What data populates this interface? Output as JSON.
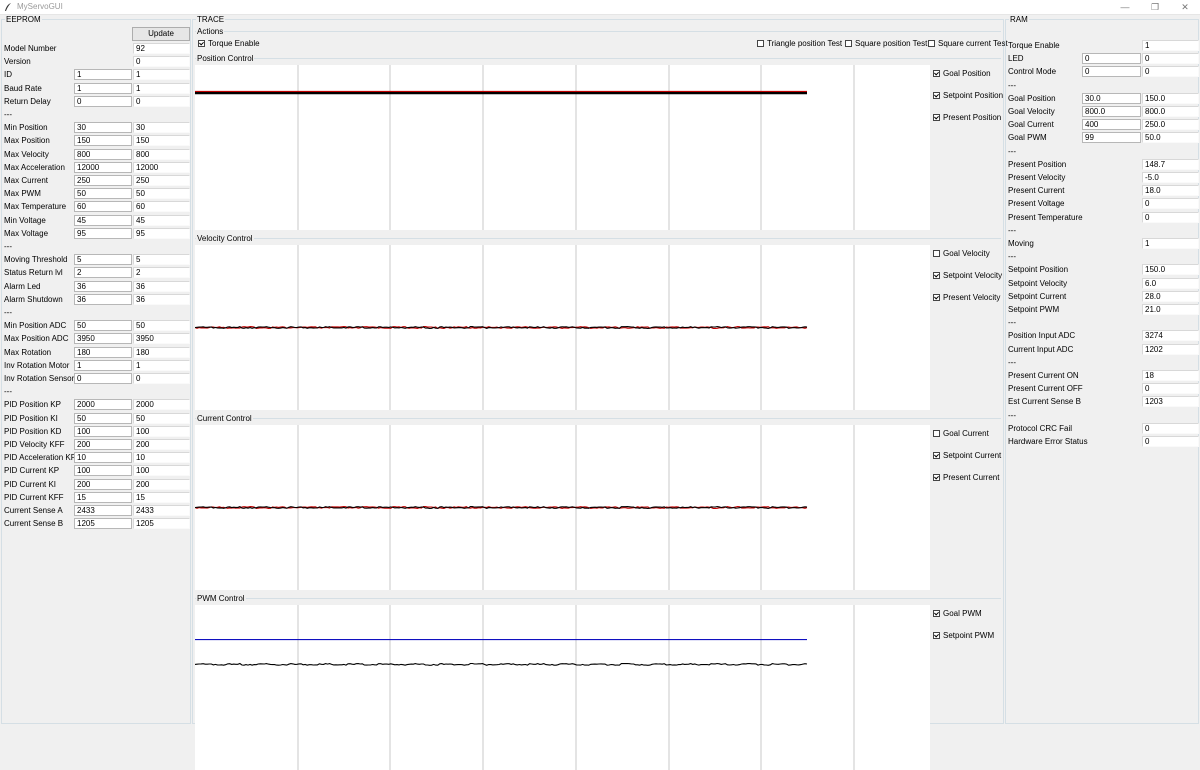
{
  "window": {
    "title": "MyServoGUI",
    "min_glyph": "—",
    "max_glyph": "❐",
    "close_glyph": "✕"
  },
  "eeprom": {
    "legend": "EEPROM",
    "update_label": "Update",
    "rows": [
      {
        "label": "Model Number",
        "value": null,
        "read": "92"
      },
      {
        "label": "Version",
        "value": null,
        "read": "0"
      },
      {
        "label": "ID",
        "value": "1",
        "read": "1"
      },
      {
        "label": "Baud Rate",
        "value": "1",
        "read": "1"
      },
      {
        "label": "Return Delay",
        "value": "0",
        "read": "0"
      },
      {
        "label": "---",
        "sep": true
      },
      {
        "label": "Min Position",
        "value": "30",
        "read": "30"
      },
      {
        "label": "Max Position",
        "value": "150",
        "read": "150"
      },
      {
        "label": "Max Velocity",
        "value": "800",
        "read": "800"
      },
      {
        "label": "Max Acceleration",
        "value": "12000",
        "read": "12000"
      },
      {
        "label": "Max Current",
        "value": "250",
        "read": "250"
      },
      {
        "label": "Max PWM",
        "value": "50",
        "read": "50"
      },
      {
        "label": "Max Temperature",
        "value": "60",
        "read": "60"
      },
      {
        "label": "Min Voltage",
        "value": "45",
        "read": "45"
      },
      {
        "label": "Max Voltage",
        "value": "95",
        "read": "95"
      },
      {
        "label": "---",
        "sep": true
      },
      {
        "label": "Moving Threshold",
        "value": "5",
        "read": "5"
      },
      {
        "label": "Status Return lvl",
        "value": "2",
        "read": "2"
      },
      {
        "label": "Alarm Led",
        "value": "36",
        "read": "36"
      },
      {
        "label": "Alarm Shutdown",
        "value": "36",
        "read": "36"
      },
      {
        "label": "---",
        "sep": true
      },
      {
        "label": "Min Position ADC",
        "value": "50",
        "read": "50"
      },
      {
        "label": "Max Position ADC",
        "value": "3950",
        "read": "3950"
      },
      {
        "label": "Max Rotation",
        "value": "180",
        "read": "180"
      },
      {
        "label": "Inv Rotation Motor",
        "value": "1",
        "read": "1"
      },
      {
        "label": "Inv Rotation Sensor",
        "value": "0",
        "read": "0"
      },
      {
        "label": "---",
        "sep": true
      },
      {
        "label": "PID Position KP",
        "value": "2000",
        "read": "2000"
      },
      {
        "label": "PID Position KI",
        "value": "50",
        "read": "50"
      },
      {
        "label": "PID Position KD",
        "value": "100",
        "read": "100"
      },
      {
        "label": "PID Velocity KFF",
        "value": "200",
        "read": "200"
      },
      {
        "label": "PID Acceleration KFF",
        "value": "10",
        "read": "10"
      },
      {
        "label": "PID Current KP",
        "value": "100",
        "read": "100"
      },
      {
        "label": "PID Current KI",
        "value": "200",
        "read": "200"
      },
      {
        "label": "PID Current KFF",
        "value": "15",
        "read": "15"
      },
      {
        "label": "Current Sense A",
        "value": "2433",
        "read": "2433"
      },
      {
        "label": "Current Sense B",
        "value": "1205",
        "read": "1205"
      }
    ]
  },
  "trace": {
    "legend": "TRACE",
    "actions": {
      "legend": "Actions",
      "torque_enable": {
        "label": "Torque Enable",
        "checked": true
      },
      "tests": [
        {
          "label": "Triangle position Test",
          "checked": false
        },
        {
          "label": "Square position Test",
          "checked": false
        },
        {
          "label": "Square current Test",
          "checked": false
        }
      ]
    },
    "panels": [
      {
        "legend": "Position Control",
        "checks": [
          {
            "label": "Goal Position",
            "checked": true
          },
          {
            "label": "Setpoint Position",
            "checked": true
          },
          {
            "label": "Present Position",
            "checked": true
          }
        ],
        "lines": [
          {
            "level": 0.84,
            "color": "#c00000"
          },
          {
            "level": 0.83,
            "color": "#000000",
            "thick": true
          }
        ]
      },
      {
        "legend": "Velocity Control",
        "checks": [
          {
            "label": "Goal Velocity",
            "checked": false
          },
          {
            "label": "Setpoint Velocity",
            "checked": true
          },
          {
            "label": "Present Velocity",
            "checked": true
          }
        ],
        "lines": [
          {
            "level": 0.5,
            "color": "#c00000",
            "noise": true
          },
          {
            "level": 0.5,
            "color": "#000000",
            "noise": true
          }
        ]
      },
      {
        "legend": "Current Control",
        "checks": [
          {
            "label": "Goal Current",
            "checked": false
          },
          {
            "label": "Setpoint Current",
            "checked": true
          },
          {
            "label": "Present Current",
            "checked": true
          }
        ],
        "lines": [
          {
            "level": 0.5,
            "color": "#c00000",
            "noise": true
          },
          {
            "level": 0.5,
            "color": "#000000",
            "noise": true
          }
        ]
      },
      {
        "legend": "PWM Control",
        "checks": [
          {
            "label": "Goal PWM",
            "checked": true
          },
          {
            "label": "Setpoint PWM",
            "checked": true
          }
        ],
        "lines": [
          {
            "level": 0.79,
            "color": "#1010c0"
          },
          {
            "level": 0.64,
            "color": "#000000",
            "noise": true
          }
        ]
      }
    ]
  },
  "ram": {
    "legend": "RAM",
    "rows": [
      {
        "label": "Torque Enable",
        "value": null,
        "read": "1"
      },
      {
        "label": "LED",
        "value": "0",
        "read": "0"
      },
      {
        "label": "Control Mode",
        "value": "0",
        "read": "0"
      },
      {
        "label": "---",
        "sep": true
      },
      {
        "label": "Goal Position",
        "value": "30.0",
        "read": "150.0"
      },
      {
        "label": "Goal Velocity",
        "value": "800.0",
        "read": "800.0"
      },
      {
        "label": "Goal Current",
        "value": "400",
        "read": "250.0"
      },
      {
        "label": "Goal PWM",
        "value": "99",
        "read": "50.0"
      },
      {
        "label": "---",
        "sep": true
      },
      {
        "label": "Present Position",
        "value": null,
        "read": "148.7"
      },
      {
        "label": "Present Velocity",
        "value": null,
        "read": "-5.0"
      },
      {
        "label": "Present Current",
        "value": null,
        "read": "18.0"
      },
      {
        "label": "Present Voltage",
        "value": null,
        "read": "0"
      },
      {
        "label": "Present Temperature",
        "value": null,
        "read": "0"
      },
      {
        "label": "---",
        "sep": true
      },
      {
        "label": "Moving",
        "value": null,
        "read": "1"
      },
      {
        "label": "---",
        "sep": true
      },
      {
        "label": "Setpoint Position",
        "value": null,
        "read": "150.0"
      },
      {
        "label": "Setpoint Velocity",
        "value": null,
        "read": "6.0"
      },
      {
        "label": "Setpoint Current",
        "value": null,
        "read": "28.0"
      },
      {
        "label": "Setpoint PWM",
        "value": null,
        "read": "21.0"
      },
      {
        "label": "---",
        "sep": true
      },
      {
        "label": "Position Input ADC",
        "value": null,
        "read": "3274"
      },
      {
        "label": "Current Input ADC",
        "value": null,
        "read": "1202"
      },
      {
        "label": "---",
        "sep": true
      },
      {
        "label": "Present Current ON",
        "value": null,
        "read": "18"
      },
      {
        "label": "Present Current OFF",
        "value": null,
        "read": "0"
      },
      {
        "label": "Est Current Sense B",
        "value": null,
        "read": "1203"
      },
      {
        "label": "---",
        "sep": true
      },
      {
        "label": "Protocol CRC Fail",
        "value": null,
        "read": "0"
      },
      {
        "label": "Hardware Error Status",
        "value": null,
        "read": "0"
      }
    ]
  }
}
